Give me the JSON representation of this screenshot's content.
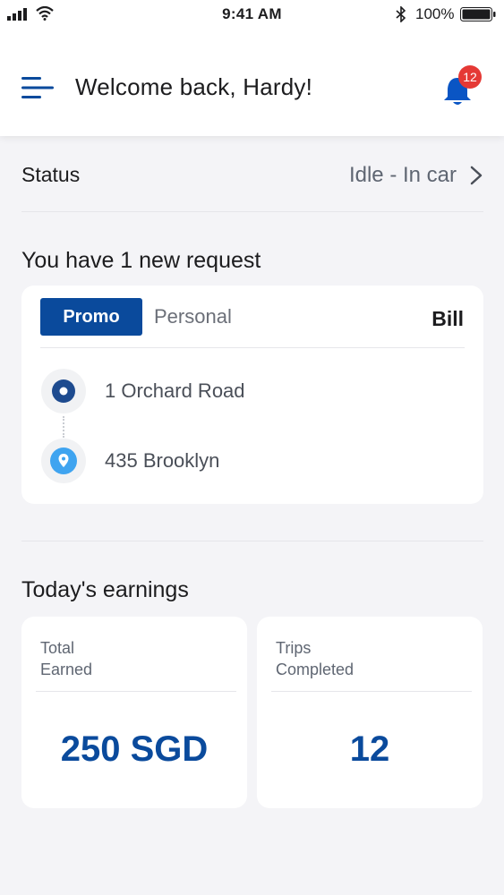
{
  "status_bar": {
    "time": "9:41 AM",
    "battery_percent": "100%"
  },
  "header": {
    "welcome": "Welcome back, Hardy!",
    "notification_count": "12"
  },
  "status": {
    "label": "Status",
    "value": "Idle - In car"
  },
  "request": {
    "section_title": "You have 1 new request",
    "tab_selected": "Promo",
    "tab_other": "Personal",
    "payment": "Bill",
    "pickup": "1 Orchard Road",
    "dropoff": "435 Brooklyn"
  },
  "earnings": {
    "section_title": "Today's earnings",
    "total_label": "Total\nEarned",
    "total_value": "250 SGD",
    "trips_label": "Trips\nCompleted",
    "trips_value": "12"
  },
  "colors": {
    "accent": "#0a4a9c",
    "badge": "#e53935",
    "pickup_dot": "#1e4b8f",
    "dropoff_pin": "#3fa4f0"
  }
}
